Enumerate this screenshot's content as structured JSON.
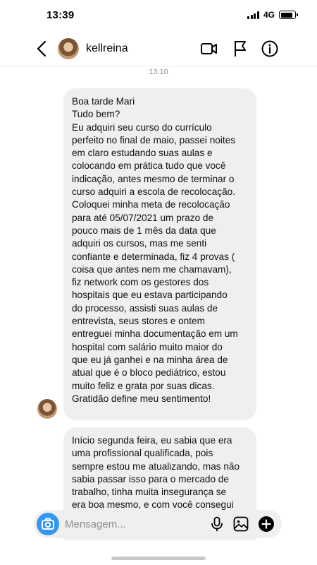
{
  "status_bar": {
    "time": "13:39",
    "network": "4G",
    "battery_level": 0.85
  },
  "header": {
    "username": "kellreina"
  },
  "timestamp": "13:10",
  "messages": [
    {
      "lines": [
        "Boa tarde Mari",
        "Tudo bem?",
        "Eu adquiri seu curso do currículo",
        "perfeito no final de maio, passei noites",
        "em claro estudando suas aulas e",
        "colocando em prática tudo que você",
        "indicação, antes mesmo de terminar o",
        "curso adquiri a escola de recolocação.",
        "Coloquei minha meta de recolocação",
        "para até 05/07/2021 um prazo de",
        "pouco mais de 1 mês da data que",
        "adquiri os cursos, mas me senti",
        "confiante e determinada, fiz 4 provas (",
        "coisa que antes nem me chamavam),",
        "fiz network com os gestores dos",
        "hospitais que eu estava participando",
        "do processo, assisti suas aulas de",
        "entrevista, seus stores e ontem",
        "entreguei minha documentação em um",
        "hospital com salário muito maior do",
        "que eu já ganhei e na minha área de",
        "atual que é o bloco pediátrico, estou",
        "muito feliz e grata por suas dicas.",
        "Gratidão define meu sentimento!"
      ]
    },
    {
      "lines": [
        "Início segunda feira, eu sabia que era",
        "uma profissional qualificada, pois",
        "sempre estou me atualizando, mas não",
        "sabia passar isso para o mercado de",
        "trabalho, tinha muita insegurança se",
        "era boa mesmo, e com você consegui"
      ]
    }
  ],
  "composer": {
    "placeholder": "Mensagem..."
  },
  "icons": {
    "back": "chevron-left-icon",
    "video": "video-camera-icon",
    "flag": "flag-icon",
    "info": "info-icon",
    "camera": "camera-icon",
    "mic": "microphone-icon",
    "gallery": "image-icon",
    "plus": "plus-circle-icon"
  },
  "colors": {
    "accent": "#3797f0",
    "bubble": "#efefef",
    "muted": "#8e8e8e"
  }
}
